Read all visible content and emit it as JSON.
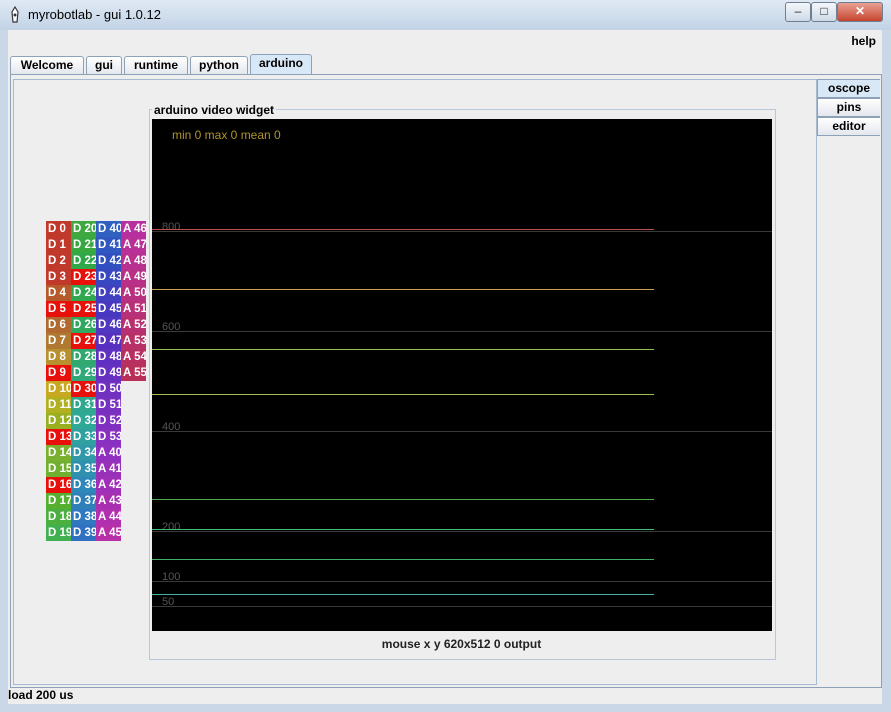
{
  "window": {
    "title": "myrobotlab - gui 1.0.12",
    "minimize": "–",
    "maximize": "□",
    "close": "✕"
  },
  "menu": {
    "help": "help"
  },
  "tabs": [
    "Welcome",
    "gui",
    "runtime",
    "python",
    "arduino"
  ],
  "active_tab": "arduino",
  "side_tabs": [
    "oscope",
    "pins",
    "editor"
  ],
  "active_side_tab": "oscope",
  "widget": {
    "title": "arduino  video widget",
    "stats": "min 0 max 0 mean 0",
    "caption": "mouse x y  620x512  0  output",
    "y_labels": [
      "800",
      "600",
      "400",
      "200",
      "100",
      "50"
    ],
    "trace_colors": [
      "#c0504d",
      "#c8a050",
      "#90c050",
      "#a0c050",
      "#50b050",
      "#40c070",
      "#40b060",
      "#40b0a0"
    ]
  },
  "pins": {
    "col1": [
      {
        "label": "D 0",
        "color": "#c0392b"
      },
      {
        "label": "D 1",
        "color": "#c0392b"
      },
      {
        "label": "D 2",
        "color": "#c0392b"
      },
      {
        "label": "D 3",
        "color": "#c0392b"
      },
      {
        "label": "D 4",
        "color": "#b55a2a"
      },
      {
        "label": "D 5",
        "color": "#e8100a"
      },
      {
        "label": "D 6",
        "color": "#b06a30"
      },
      {
        "label": "D 7",
        "color": "#b07830"
      },
      {
        "label": "D 8",
        "color": "#b89030"
      },
      {
        "label": "D 9",
        "color": "#e8100a"
      },
      {
        "label": "D 10",
        "color": "#c8a820"
      },
      {
        "label": "D 11",
        "color": "#b0b020"
      },
      {
        "label": "D 12",
        "color": "#98b020"
      },
      {
        "label": "D 13",
        "color": "#e8100a"
      },
      {
        "label": "D 14",
        "color": "#7ab030"
      },
      {
        "label": "D 15",
        "color": "#70b030"
      },
      {
        "label": "D 16",
        "color": "#e8100a"
      },
      {
        "label": "D 17",
        "color": "#55b030"
      },
      {
        "label": "D 18",
        "color": "#4cb040"
      },
      {
        "label": "D 19",
        "color": "#40b050"
      }
    ],
    "col2": [
      {
        "label": "D 20",
        "color": "#40a840"
      },
      {
        "label": "D 21",
        "color": "#38a840"
      },
      {
        "label": "D 22",
        "color": "#30a848"
      },
      {
        "label": "D 23",
        "color": "#e8100a"
      },
      {
        "label": "D 24",
        "color": "#30a850"
      },
      {
        "label": "D 25",
        "color": "#e8100a"
      },
      {
        "label": "D 26",
        "color": "#30a860"
      },
      {
        "label": "D 27",
        "color": "#e8100a"
      },
      {
        "label": "D 28",
        "color": "#30a870"
      },
      {
        "label": "D 29",
        "color": "#30a878"
      },
      {
        "label": "D 30",
        "color": "#e8100a"
      },
      {
        "label": "D 31",
        "color": "#30a890"
      },
      {
        "label": "D 32",
        "color": "#30a898"
      },
      {
        "label": "D 33",
        "color": "#30a0a0"
      },
      {
        "label": "D 34",
        "color": "#3098a8"
      },
      {
        "label": "D 35",
        "color": "#3090b0"
      },
      {
        "label": "D 36",
        "color": "#3088b8"
      },
      {
        "label": "D 37",
        "color": "#3080b8"
      },
      {
        "label": "D 38",
        "color": "#3078c0"
      },
      {
        "label": "D 39",
        "color": "#3070c0"
      }
    ],
    "col3": [
      {
        "label": "D 40",
        "color": "#3060c0"
      },
      {
        "label": "D 41",
        "color": "#3058c0"
      },
      {
        "label": "D 42",
        "color": "#3050c0"
      },
      {
        "label": "D 43",
        "color": "#3848c0"
      },
      {
        "label": "D 44",
        "color": "#4040c0"
      },
      {
        "label": "D 45",
        "color": "#4838c0"
      },
      {
        "label": "D 46",
        "color": "#5038c0"
      },
      {
        "label": "D 47",
        "color": "#5830c0"
      },
      {
        "label": "D 48",
        "color": "#6030c0"
      },
      {
        "label": "D 49",
        "color": "#6830c0"
      },
      {
        "label": "D 50",
        "color": "#7030c0"
      },
      {
        "label": "D 51",
        "color": "#7830c0"
      },
      {
        "label": "D 52",
        "color": "#8030c0"
      },
      {
        "label": "D 53",
        "color": "#8830c0"
      },
      {
        "label": "A 40",
        "color": "#9030c0"
      },
      {
        "label": "A 41",
        "color": "#9830b8"
      },
      {
        "label": "A 42",
        "color": "#a030b8"
      },
      {
        "label": "A 43",
        "color": "#a830b0"
      },
      {
        "label": "A 44",
        "color": "#b030b0"
      },
      {
        "label": "A 45",
        "color": "#b830a8"
      }
    ],
    "col4": [
      {
        "label": "A 46",
        "color": "#b830a0"
      },
      {
        "label": "A 47",
        "color": "#b83098"
      },
      {
        "label": "A 48",
        "color": "#b83090"
      },
      {
        "label": "A 49",
        "color": "#b83088"
      },
      {
        "label": "A 50",
        "color": "#b83080"
      },
      {
        "label": "A 51",
        "color": "#b83078"
      },
      {
        "label": "A 52",
        "color": "#b83070"
      },
      {
        "label": "A 53",
        "color": "#b83068"
      },
      {
        "label": "A 54",
        "color": "#b83060"
      },
      {
        "label": "A 55",
        "color": "#b83058"
      }
    ]
  },
  "status": "load 200 us"
}
